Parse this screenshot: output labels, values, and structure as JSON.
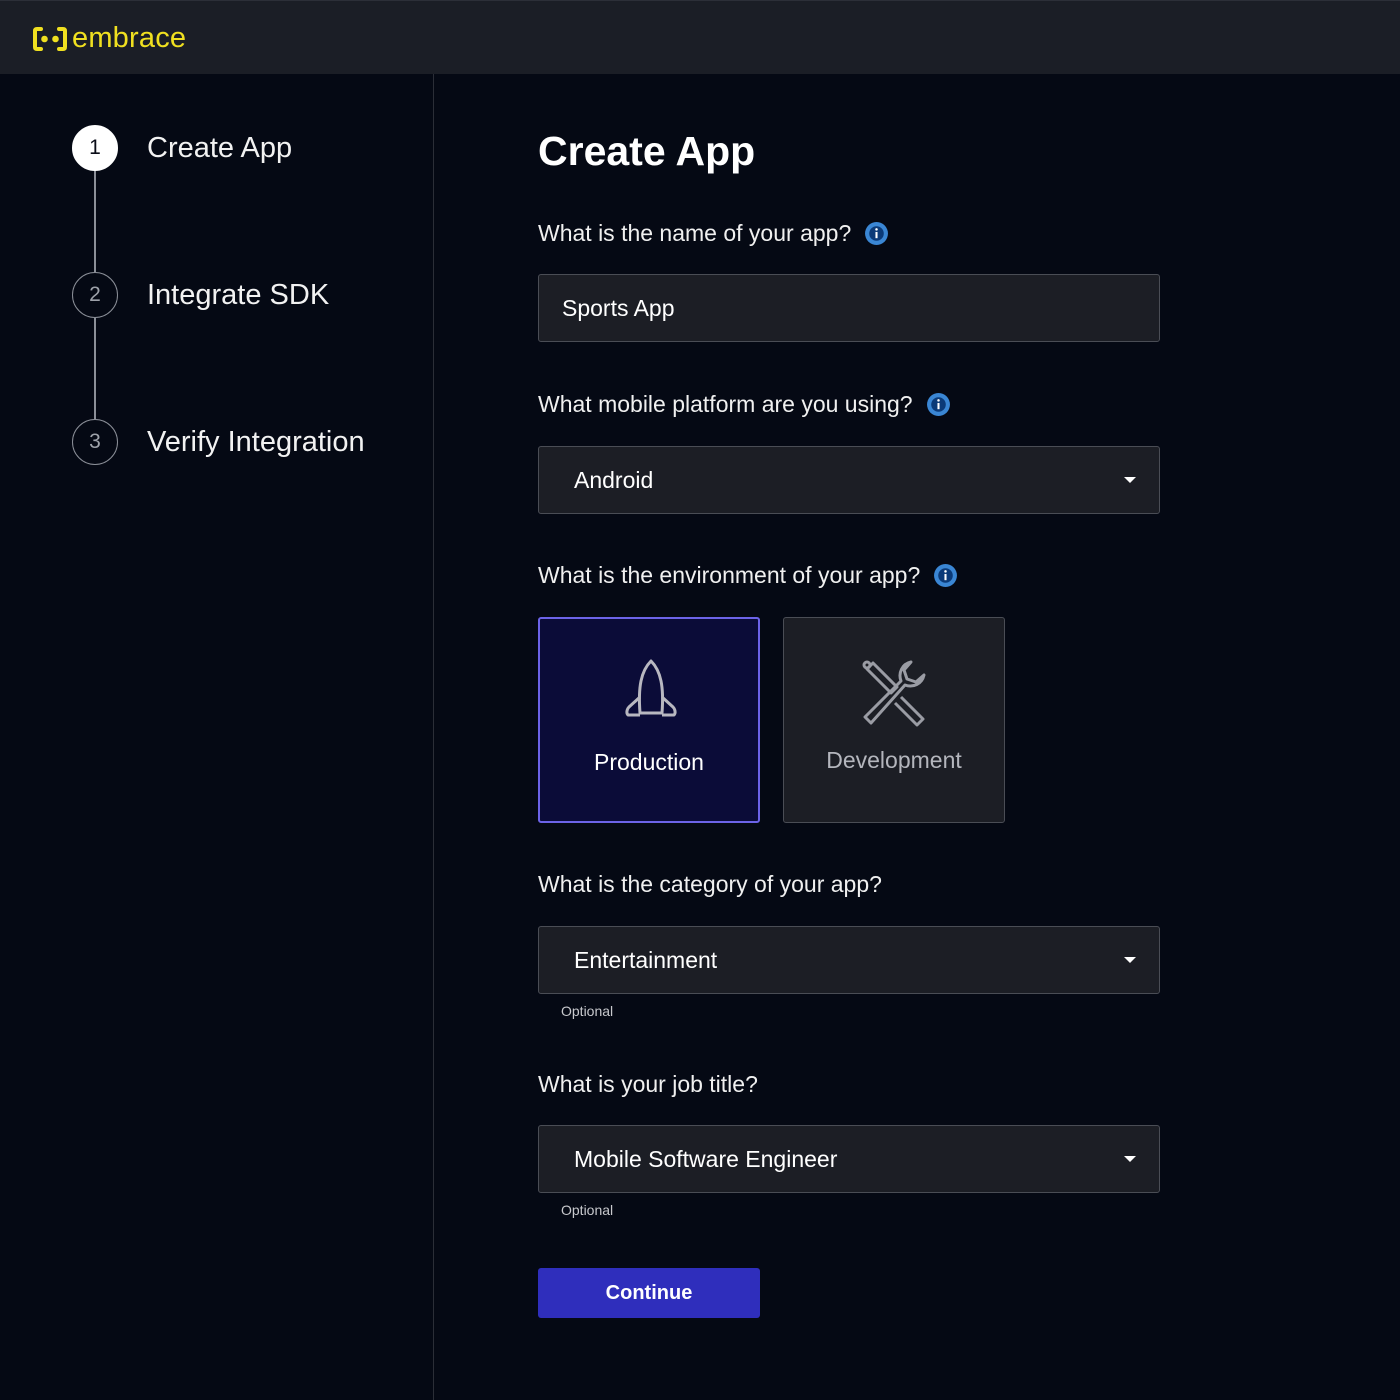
{
  "header": {
    "logo_icon": "embrace-bracket-logo",
    "brand": "embrace",
    "brand_color": "#f0e020"
  },
  "steps": [
    {
      "number": "1",
      "label": "Create App",
      "active": true
    },
    {
      "number": "2",
      "label": "Integrate SDK",
      "active": false
    },
    {
      "number": "3",
      "label": "Verify Integration",
      "active": false
    }
  ],
  "form": {
    "title": "Create App",
    "app_name": {
      "question": "What is the name of your app?",
      "value": "Sports App",
      "icon": "info-icon"
    },
    "platform": {
      "question": "What mobile platform are you using?",
      "value": "Android",
      "icon": "info-icon"
    },
    "environment": {
      "question": "What is the environment of your app?",
      "icon": "info-icon",
      "options": [
        {
          "label": "Production",
          "icon": "rocket-icon",
          "selected": true
        },
        {
          "label": "Development",
          "icon": "tools-icon",
          "selected": false
        }
      ]
    },
    "category": {
      "question": "What is the category of your app?",
      "value": "Entertainment",
      "helper": "Optional"
    },
    "job_title": {
      "question": "What is your job title?",
      "value": "Mobile Software Engineer",
      "helper": "Optional"
    },
    "continue_label": "Continue"
  },
  "colors": {
    "accent": "#2f2ebc",
    "selected_border": "#6c63e8",
    "info_icon": "#3a86d4"
  }
}
